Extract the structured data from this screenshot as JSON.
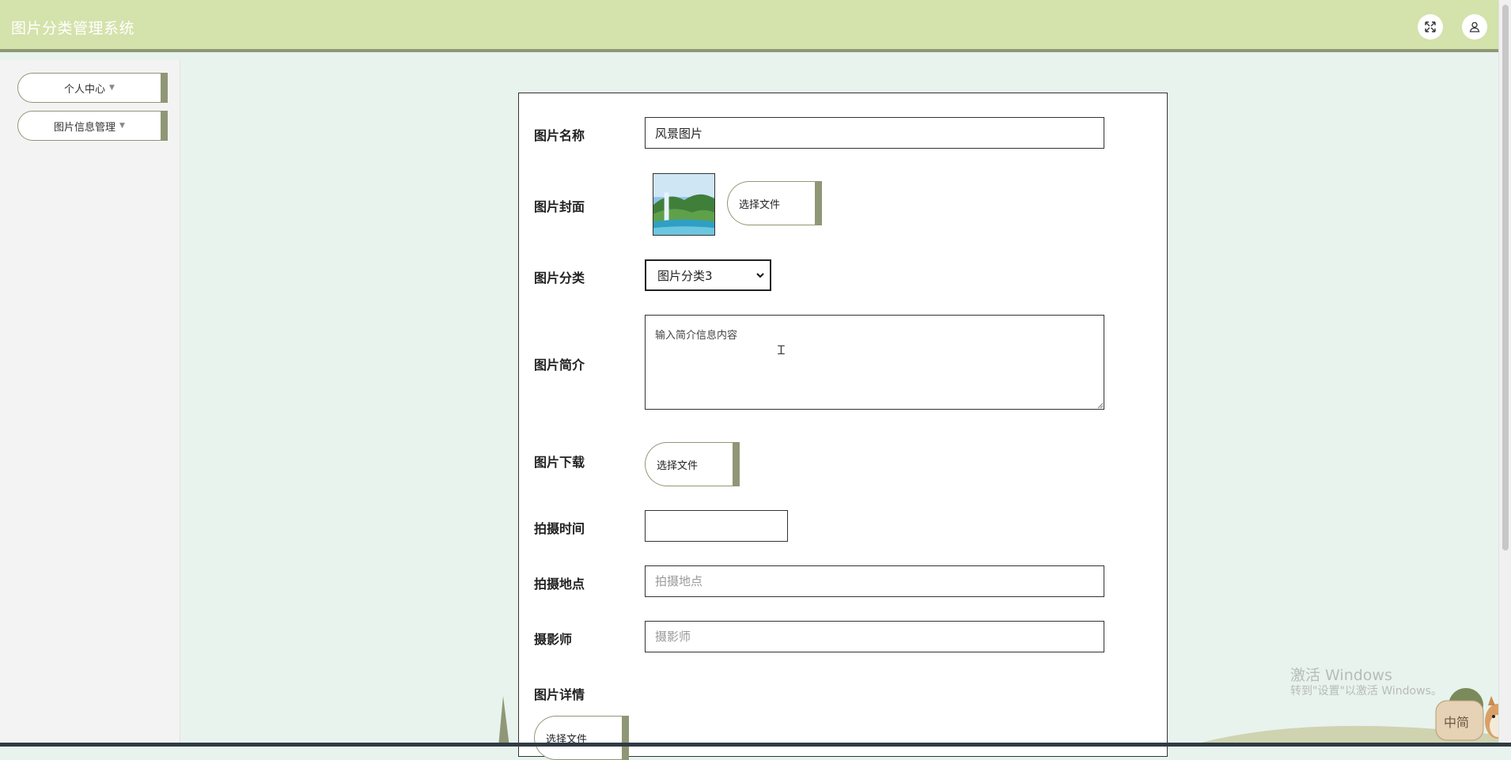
{
  "app": {
    "title": "图片分类管理系统"
  },
  "header": {
    "fullscreen_icon": "expand-icon",
    "user_icon": "user-icon"
  },
  "sidebar": {
    "items": [
      {
        "label": "个人中心",
        "caret": "▼"
      },
      {
        "label": "图片信息管理",
        "caret": "▼"
      }
    ]
  },
  "form": {
    "name": {
      "label": "图片名称",
      "value": "风景图片"
    },
    "cover": {
      "label": "图片封面",
      "button": "选择文件"
    },
    "category": {
      "label": "图片分类",
      "selected": "图片分类3"
    },
    "intro": {
      "label": "图片简介",
      "placeholder": "输入简介信息内容"
    },
    "download": {
      "label": "图片下载",
      "button": "选择文件"
    },
    "shoot_time": {
      "label": "拍摄时间",
      "value": ""
    },
    "location": {
      "label": "拍摄地点",
      "placeholder": "拍摄地点"
    },
    "photographer": {
      "label": "摄影师",
      "placeholder": "摄影师"
    },
    "details": {
      "label": "图片详情",
      "button": "选择文件"
    }
  },
  "watermark": {
    "line1": "激活 Windows",
    "line2": "转到\"设置\"以激活 Windows。"
  },
  "ime": {
    "label": "中简"
  },
  "colors": {
    "header_bg": "#d4e2ab",
    "accent": "#8f9776",
    "page_bg": "#e8f3ee"
  }
}
